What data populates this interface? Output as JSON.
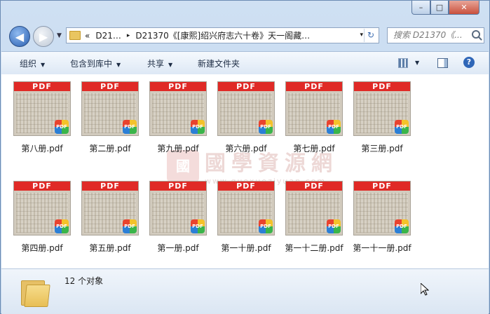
{
  "window": {
    "title": "",
    "min": "–",
    "max": "□",
    "close": "✕"
  },
  "nav": {
    "back_icon": "back-arrow-icon",
    "forward_icon": "forward-arrow-icon"
  },
  "address": {
    "chevrons": "«",
    "crumb1": "D21…",
    "sep": "▸",
    "crumb2": "D21370《[康熙]绍兴府志六十卷》天一阁藏…",
    "dropdown": "▾",
    "refresh": "↻"
  },
  "search": {
    "placeholder": "搜索 D21370《..."
  },
  "toolbar": {
    "organize": "组织",
    "include_library": "包含到库中",
    "share": "共享",
    "new_folder": "新建文件夹"
  },
  "files": [
    {
      "name": "第八册.pdf"
    },
    {
      "name": "第二册.pdf"
    },
    {
      "name": "第九册.pdf"
    },
    {
      "name": "第六册.pdf"
    },
    {
      "name": "第七册.pdf"
    },
    {
      "name": "第三册.pdf"
    },
    {
      "name": "第四册.pdf"
    },
    {
      "name": "第五册.pdf"
    },
    {
      "name": "第一册.pdf"
    },
    {
      "name": "第一十册.pdf"
    },
    {
      "name": "第一十二册.pdf"
    },
    {
      "name": "第一十一册.pdf"
    }
  ],
  "thumb_text": {
    "pdf": "PDF",
    "badge": "PDF"
  },
  "watermark": {
    "seal": "國",
    "title": "國學資源網",
    "url": "www.guoxueziyuan.com"
  },
  "status": {
    "count": "12 个对象"
  }
}
